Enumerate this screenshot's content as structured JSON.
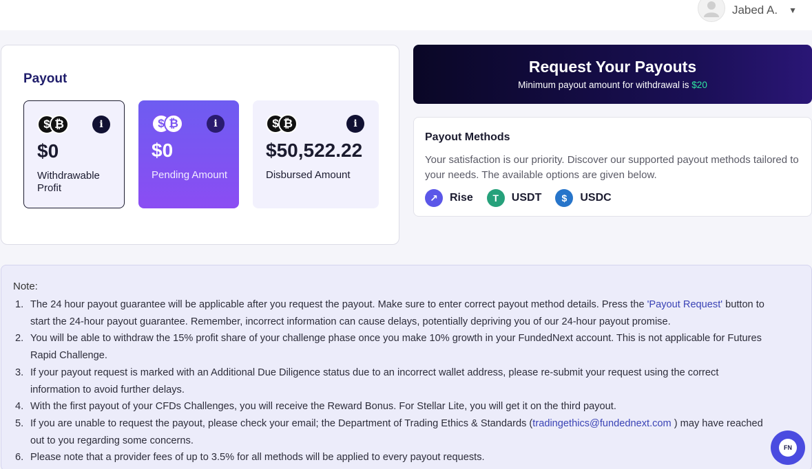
{
  "user": {
    "name": "Jabed A."
  },
  "payout": {
    "title": "Payout",
    "stats": [
      {
        "amount": "$0",
        "label": "Withdrawable Profit"
      },
      {
        "amount": "$0",
        "label": "Pending Amount"
      },
      {
        "amount": "$50,522.22",
        "label": "Disbursed Amount"
      }
    ]
  },
  "request": {
    "title": "Request Your Payouts",
    "subtitle": "Minimum payout amount for withdrawal is",
    "min_amount": "$20"
  },
  "methods": {
    "title": "Payout Methods",
    "description": "Your satisfaction is our priority. Discover our supported payout methods tailored to your needs. The available options are given below.",
    "items": [
      {
        "label": "Rise",
        "icon": "rise-icon",
        "color": "#5b57e8"
      },
      {
        "label": "USDT",
        "icon": "usdt-icon",
        "color": "#26a17b"
      },
      {
        "label": "USDC",
        "icon": "usdc-icon",
        "color": "#2775ca"
      }
    ]
  },
  "note": {
    "title": "Note:",
    "items": [
      {
        "num": "1.",
        "before": "The 24 hour payout guarantee will be applicable after you request the payout. Make sure to enter correct payout method details. Press the ",
        "link": "'Payout Request'",
        "after": " button to start the 24-hour payout guarantee. Remember, incorrect information can cause delays, potentially depriving you of our 24-hour payout promise."
      },
      {
        "num": "2.",
        "before": "You will be able to withdraw the 15% profit share of your challenge phase once you make 10% growth in your FundedNext account. This is not applicable for Futures Rapid Challenge.",
        "link": "",
        "after": ""
      },
      {
        "num": "3.",
        "before": "If your payout request is marked with an Additional Due Diligence status due to an incorrect wallet address, please re-submit your request using the correct information to avoid further delays.",
        "link": "",
        "after": ""
      },
      {
        "num": "4.",
        "before": "With the first payout of your CFDs Challenges, you will receive the Reward Bonus. For Stellar Lite, you will get it on the third payout.",
        "link": "",
        "after": ""
      },
      {
        "num": "5.",
        "before": "If you are unable to request the payout, please check your email; the Department of Trading Ethics & Standards (",
        "link": "tradingethics@fundednext.com",
        "after": " ) may have reached out to you regarding some concerns."
      },
      {
        "num": "6.",
        "before": "Please note that a provider fees of up to 3.5% for all methods will be applied to every payout requests.",
        "link": "",
        "after": ""
      }
    ]
  },
  "chat": {
    "label": "FN"
  }
}
